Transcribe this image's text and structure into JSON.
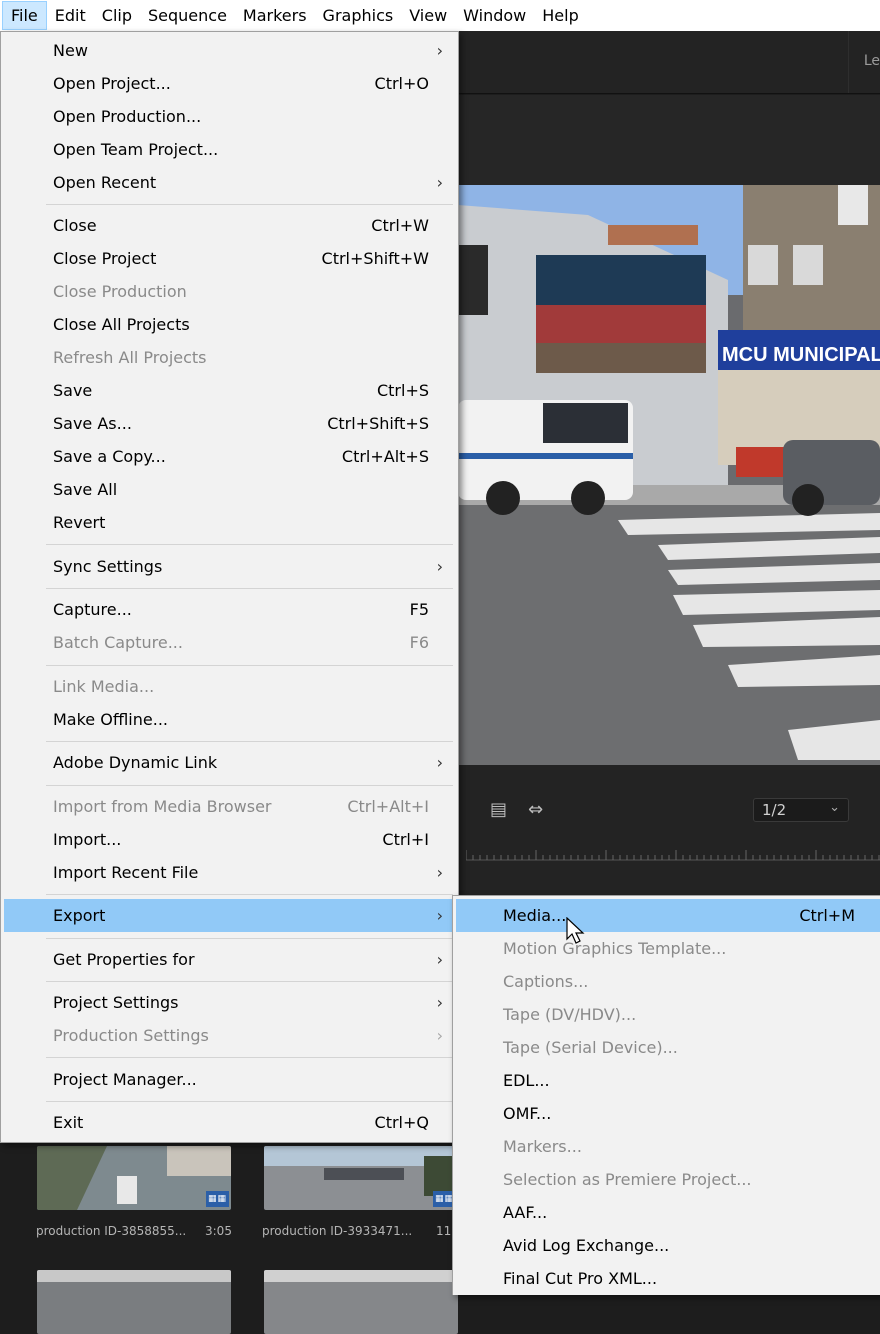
{
  "menubar": {
    "items": [
      "File",
      "Edit",
      "Clip",
      "Sequence",
      "Markers",
      "Graphics",
      "View",
      "Window",
      "Help"
    ],
    "active_index": 0
  },
  "background": {
    "panel_top_text": "Le",
    "program_monitor": {
      "zoom_value": "1/2",
      "storefront_sign": "MCU MUNICIPAL CRE"
    },
    "bin_items": [
      {
        "name": "production ID-3858855...",
        "duration": "3:05"
      },
      {
        "name": "production ID-3933471...",
        "duration": "11"
      }
    ]
  },
  "file_menu": {
    "items": [
      {
        "label": "New",
        "shortcut": "",
        "submenu": true,
        "disabled": false
      },
      {
        "label": "Open Project...",
        "shortcut": "Ctrl+O",
        "submenu": false,
        "disabled": false
      },
      {
        "label": "Open Production...",
        "shortcut": "",
        "submenu": false,
        "disabled": false
      },
      {
        "label": "Open Team Project...",
        "shortcut": "",
        "submenu": false,
        "disabled": false
      },
      {
        "label": "Open Recent",
        "shortcut": "",
        "submenu": true,
        "disabled": false
      },
      {
        "label": "Close",
        "shortcut": "Ctrl+W",
        "submenu": false,
        "disabled": false
      },
      {
        "label": "Close Project",
        "shortcut": "Ctrl+Shift+W",
        "submenu": false,
        "disabled": false
      },
      {
        "label": "Close Production",
        "shortcut": "",
        "submenu": false,
        "disabled": true
      },
      {
        "label": "Close All Projects",
        "shortcut": "",
        "submenu": false,
        "disabled": false
      },
      {
        "label": "Refresh All Projects",
        "shortcut": "",
        "submenu": false,
        "disabled": true
      },
      {
        "label": "Save",
        "shortcut": "Ctrl+S",
        "submenu": false,
        "disabled": false
      },
      {
        "label": "Save As...",
        "shortcut": "Ctrl+Shift+S",
        "submenu": false,
        "disabled": false
      },
      {
        "label": "Save a Copy...",
        "shortcut": "Ctrl+Alt+S",
        "submenu": false,
        "disabled": false
      },
      {
        "label": "Save All",
        "shortcut": "",
        "submenu": false,
        "disabled": false
      },
      {
        "label": "Revert",
        "shortcut": "",
        "submenu": false,
        "disabled": false
      },
      {
        "label": "Sync Settings",
        "shortcut": "",
        "submenu": true,
        "disabled": false
      },
      {
        "label": "Capture...",
        "shortcut": "F5",
        "submenu": false,
        "disabled": false
      },
      {
        "label": "Batch Capture...",
        "shortcut": "F6",
        "submenu": false,
        "disabled": true
      },
      {
        "label": "Link Media...",
        "shortcut": "",
        "submenu": false,
        "disabled": true
      },
      {
        "label": "Make Offline...",
        "shortcut": "",
        "submenu": false,
        "disabled": false
      },
      {
        "label": "Adobe Dynamic Link",
        "shortcut": "",
        "submenu": true,
        "disabled": false
      },
      {
        "label": "Import from Media Browser",
        "shortcut": "Ctrl+Alt+I",
        "submenu": false,
        "disabled": true
      },
      {
        "label": "Import...",
        "shortcut": "Ctrl+I",
        "submenu": false,
        "disabled": false
      },
      {
        "label": "Import Recent File",
        "shortcut": "",
        "submenu": true,
        "disabled": false
      },
      {
        "label": "Export",
        "shortcut": "",
        "submenu": true,
        "disabled": false,
        "highlighted": true
      },
      {
        "label": "Get Properties for",
        "shortcut": "",
        "submenu": true,
        "disabled": false
      },
      {
        "label": "Project Settings",
        "shortcut": "",
        "submenu": true,
        "disabled": false
      },
      {
        "label": "Production Settings",
        "shortcut": "",
        "submenu": true,
        "disabled": true
      },
      {
        "label": "Project Manager...",
        "shortcut": "",
        "submenu": false,
        "disabled": false
      },
      {
        "label": "Exit",
        "shortcut": "Ctrl+Q",
        "submenu": false,
        "disabled": false
      }
    ]
  },
  "export_menu": {
    "items": [
      {
        "label": "Media...",
        "shortcut": "Ctrl+M",
        "disabled": false,
        "highlighted": true
      },
      {
        "label": "Motion Graphics Template...",
        "shortcut": "",
        "disabled": true
      },
      {
        "label": "Captions...",
        "shortcut": "",
        "disabled": true
      },
      {
        "label": "Tape (DV/HDV)...",
        "shortcut": "",
        "disabled": true
      },
      {
        "label": "Tape (Serial Device)...",
        "shortcut": "",
        "disabled": true
      },
      {
        "label": "EDL...",
        "shortcut": "",
        "disabled": false
      },
      {
        "label": "OMF...",
        "shortcut": "",
        "disabled": false
      },
      {
        "label": "Markers...",
        "shortcut": "",
        "disabled": true
      },
      {
        "label": "Selection as Premiere Project...",
        "shortcut": "",
        "disabled": true
      },
      {
        "label": "AAF...",
        "shortcut": "",
        "disabled": false
      },
      {
        "label": "Avid Log Exchange...",
        "shortcut": "",
        "disabled": false
      },
      {
        "label": "Final Cut Pro XML...",
        "shortcut": "",
        "disabled": false
      }
    ]
  },
  "colors": {
    "highlight": "#91c9f7",
    "menu_bg": "#f2f2f2",
    "disabled_text": "#8a8a8a",
    "menubar_active": "#cce8ff"
  }
}
